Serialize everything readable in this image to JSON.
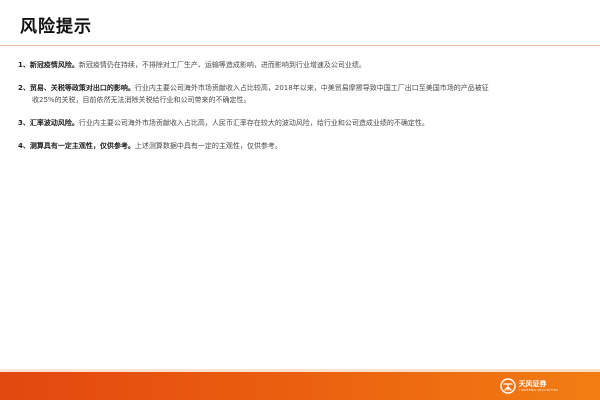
{
  "page": {
    "title": "风险提示"
  },
  "risks": [
    {
      "head": "1、新冠疫情风险。",
      "body": "新冠疫情仍在持续，不排除对工厂生产、运输等造成影响，进而影响到行业增速及公司业绩。"
    },
    {
      "head": "2、贸易、关税等政策对出口的影响。",
      "body": "行业内主要公司海外市场贡献收入占比较高，2018年以来，中美贸易摩擦导致中国工厂出口至美国市场的产品被征",
      "body2": "收25%的关税，目前依然无法消除关税给行业和公司带来的不确定性。"
    },
    {
      "head": "3、汇率波动风险。",
      "body": "行业内主要公司海外市场贡献收入占比高，人民币汇率存在较大的波动风险，给行业和公司造成业绩的不确定性。"
    },
    {
      "head": "4、测算具有一定主观性，仅供参考。",
      "body": "上述测算数据中具有一定的主观性，仅供参考。"
    }
  ],
  "footer": {
    "brand_color": "#e94f10",
    "logo_name": "天风证券",
    "logo_sub": "TIANFENG SECURITIES",
    "logo_icon": "tianfeng-logo-icon"
  }
}
